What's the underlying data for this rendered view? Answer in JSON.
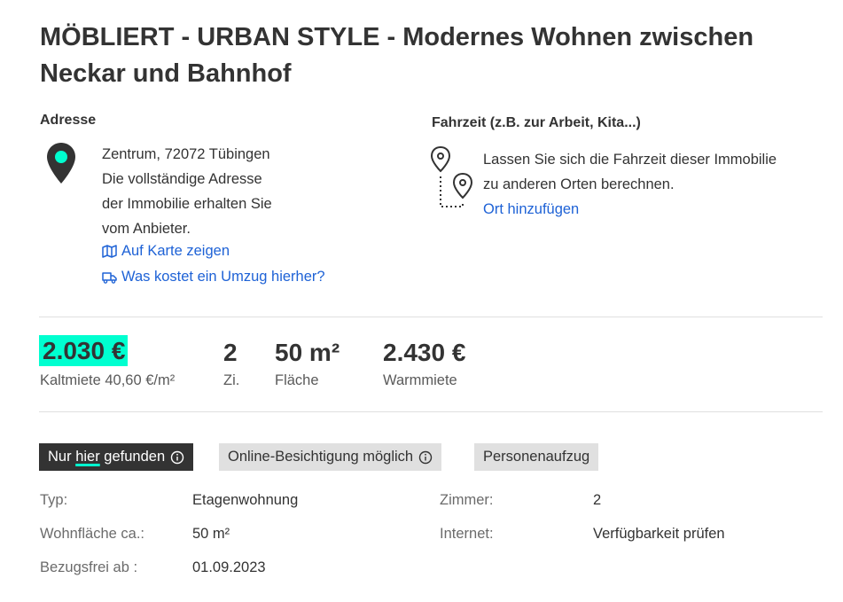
{
  "title": "MÖBLIERT - URBAN STYLE - Modernes Wohnen zwischen Neckar und Bahnhof",
  "address": {
    "heading": "Adresse",
    "lines": [
      "Zentrum, 72072 Tübingen",
      "Die vollständige Adresse",
      "der Immobilie erhalten Sie",
      "vom Anbieter."
    ],
    "map_link": "Auf Karte zeigen",
    "move_link": "Was kostet ein Umzug hierher?"
  },
  "commute": {
    "heading": "Fahrzeit (z.B. zur Arbeit, Kita...)",
    "lines": [
      "Lassen Sie sich die Fahrzeit dieser Immobilie",
      "zu anderen Orten berechnen."
    ],
    "add_link": "Ort hinzufügen"
  },
  "key_facts": {
    "rent_cold": "2.030 €",
    "rent_cold_label": "Kaltmiete 40,60 €/m²",
    "rooms": "2",
    "rooms_label": "Zi.",
    "area": "50 m²",
    "area_label": "Fläche",
    "rent_warm": "2.430 €",
    "rent_warm_label": "Warmmiete"
  },
  "tags": {
    "found_prefix": "Nur",
    "found_hier": "hier",
    "found_suffix": "gefunden",
    "online": "Online-Besichtigung möglich",
    "lift": "Personenaufzug"
  },
  "attributes": {
    "type_label": "Typ:",
    "type_value": "Etagenwohnung",
    "area_label": "Wohnfläche ca.:",
    "area_value": "50 m²",
    "available_label": "Bezugsfrei ab :",
    "available_value": "01.09.2023",
    "rooms_label": "Zimmer:",
    "rooms_value": "2",
    "internet_label": "Internet:",
    "internet_value": "Verfügbarkeit prüfen"
  },
  "colors": {
    "accent": "#00ffd0",
    "link": "#1e62d6",
    "text": "#333333"
  },
  "icons": [
    "map-pin-icon",
    "map-icon",
    "moving-truck-icon",
    "route-pins-icon",
    "info-icon"
  ]
}
